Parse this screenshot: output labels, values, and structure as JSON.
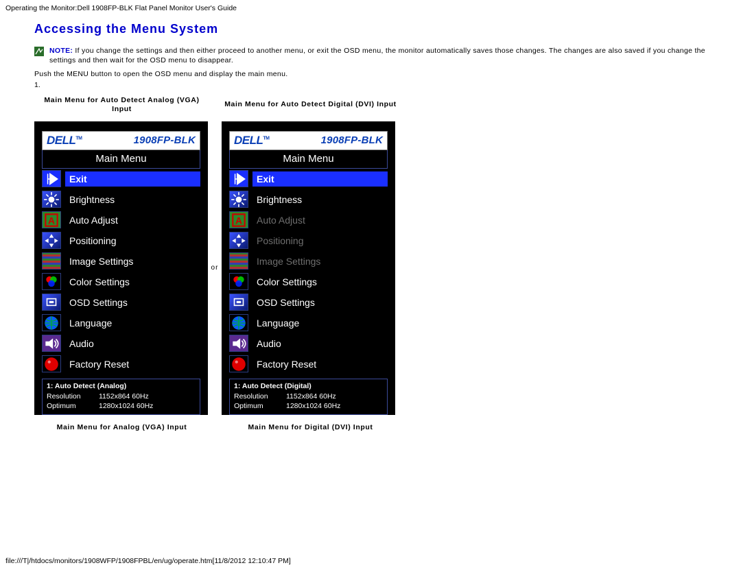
{
  "header_line": "Operating the Monitor:Dell 1908FP-BLK Flat Panel Monitor User's Guide",
  "heading": "Accessing the Menu System",
  "note": {
    "label": "NOTE:",
    "text": " If you change the settings and then either proceed to another menu, or exit the OSD menu, the monitor automatically saves those changes. The changes are also saved if you change the settings and then wait for the OSD menu to disappear."
  },
  "push_line": "Push the MENU button to open the OSD menu and display the main menu.",
  "list_number": "1.",
  "captions_top": {
    "left": "Main Menu for Auto Detect Analog (VGA) Input",
    "right": "Main Menu for Auto Detect Digital (DVI) Input"
  },
  "or_label": "or",
  "captions_bottom": {
    "left": "Main Menu for Analog (VGA) Input",
    "right": "Main Menu for Digital (DVI) Input"
  },
  "osd": {
    "brand": "DELL",
    "tm": "TM",
    "model": "1908FP-BLK",
    "main_title": "Main Menu",
    "items": [
      {
        "label": "Exit"
      },
      {
        "label": "Brightness"
      },
      {
        "label": "Auto Adjust"
      },
      {
        "label": "Positioning"
      },
      {
        "label": "Image Settings"
      },
      {
        "label": "Color Settings"
      },
      {
        "label": "OSD Settings"
      },
      {
        "label": "Language"
      },
      {
        "label": "Audio"
      },
      {
        "label": "Factory Reset"
      }
    ],
    "status_analog": {
      "title": "1: Auto Detect (Analog)",
      "rows": [
        {
          "k": "Resolution",
          "v": "1152x864   60Hz"
        },
        {
          "k": "Optimum",
          "v": "1280x1024  60Hz"
        }
      ]
    },
    "status_digital": {
      "title": "1: Auto Detect (Digital)",
      "rows": [
        {
          "k": "Resolution",
          "v": "1152x864   60Hz"
        },
        {
          "k": "Optimum",
          "v": "1280x1024  60Hz"
        }
      ]
    }
  },
  "footer_url": "file:///T|/htdocs/monitors/1908WFP/1908FPBL/en/ug/operate.htm[11/8/2012 12:10:47 PM]"
}
